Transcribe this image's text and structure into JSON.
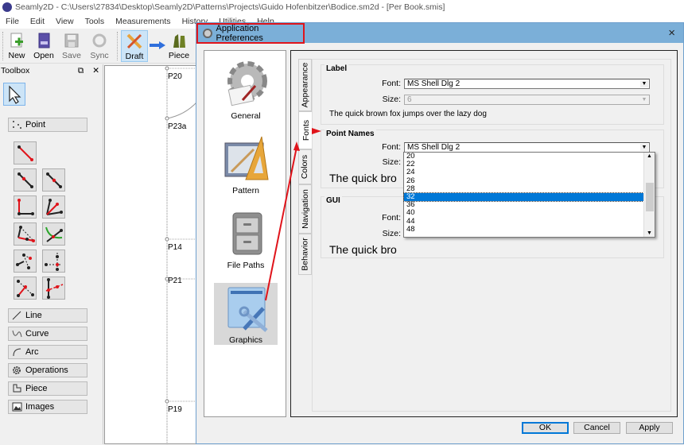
{
  "window": {
    "title": "Seamly2D - C:\\Users\\27834\\Desktop\\Seamly2D\\Patterns\\Projects\\Guido Hofenbitzer\\Bodice.sm2d - [Per Book.smis]"
  },
  "menu": [
    "File",
    "Edit",
    "View",
    "Tools",
    "Measurements",
    "History",
    "Utilities",
    "Help"
  ],
  "toolbar": {
    "new": "New",
    "open": "Open",
    "save": "Save",
    "sync": "Sync",
    "draft": "Draft",
    "piece": "Piece"
  },
  "toolbox": {
    "title": "Toolbox",
    "groups": {
      "point": "Point",
      "line": "Line",
      "curve": "Curve",
      "arc": "Arc",
      "operations": "Operations",
      "piece": "Piece",
      "images": "Images"
    }
  },
  "canvas": {
    "points": [
      "P20",
      "P23a",
      "P14",
      "P21",
      "P19"
    ]
  },
  "dialog": {
    "title": "Application Preferences",
    "close": "×",
    "categories": [
      {
        "label": "General"
      },
      {
        "label": "Pattern"
      },
      {
        "label": "File Paths"
      },
      {
        "label": "Graphics"
      }
    ],
    "selected_category": "Graphics",
    "tabs": [
      "Appearance",
      "Fonts",
      "Colors",
      "Navigation",
      "Behavior"
    ],
    "active_tab": "Fonts",
    "font_label": "Font:",
    "size_label": "Size:",
    "label_group": {
      "title": "Label",
      "font": "MS Shell Dlg 2",
      "size": "6",
      "sample": "The quick brown fox jumps over the lazy dog"
    },
    "point_names_group": {
      "title": "Point Names",
      "font": "MS Shell Dlg 2",
      "size": "32",
      "sample": "The quick bro"
    },
    "gui_group": {
      "title": "GUI",
      "sample": "The quick bro"
    },
    "size_dropdown": {
      "options": [
        "20",
        "22",
        "24",
        "26",
        "28",
        "32",
        "36",
        "40",
        "44",
        "48"
      ],
      "selected": "32"
    },
    "buttons": {
      "ok": "OK",
      "cancel": "Cancel",
      "apply": "Apply"
    }
  },
  "colors": {
    "annotation_red": "#e0141b",
    "selection_blue": "#0078d7",
    "dialog_title": "#7bafd8"
  }
}
